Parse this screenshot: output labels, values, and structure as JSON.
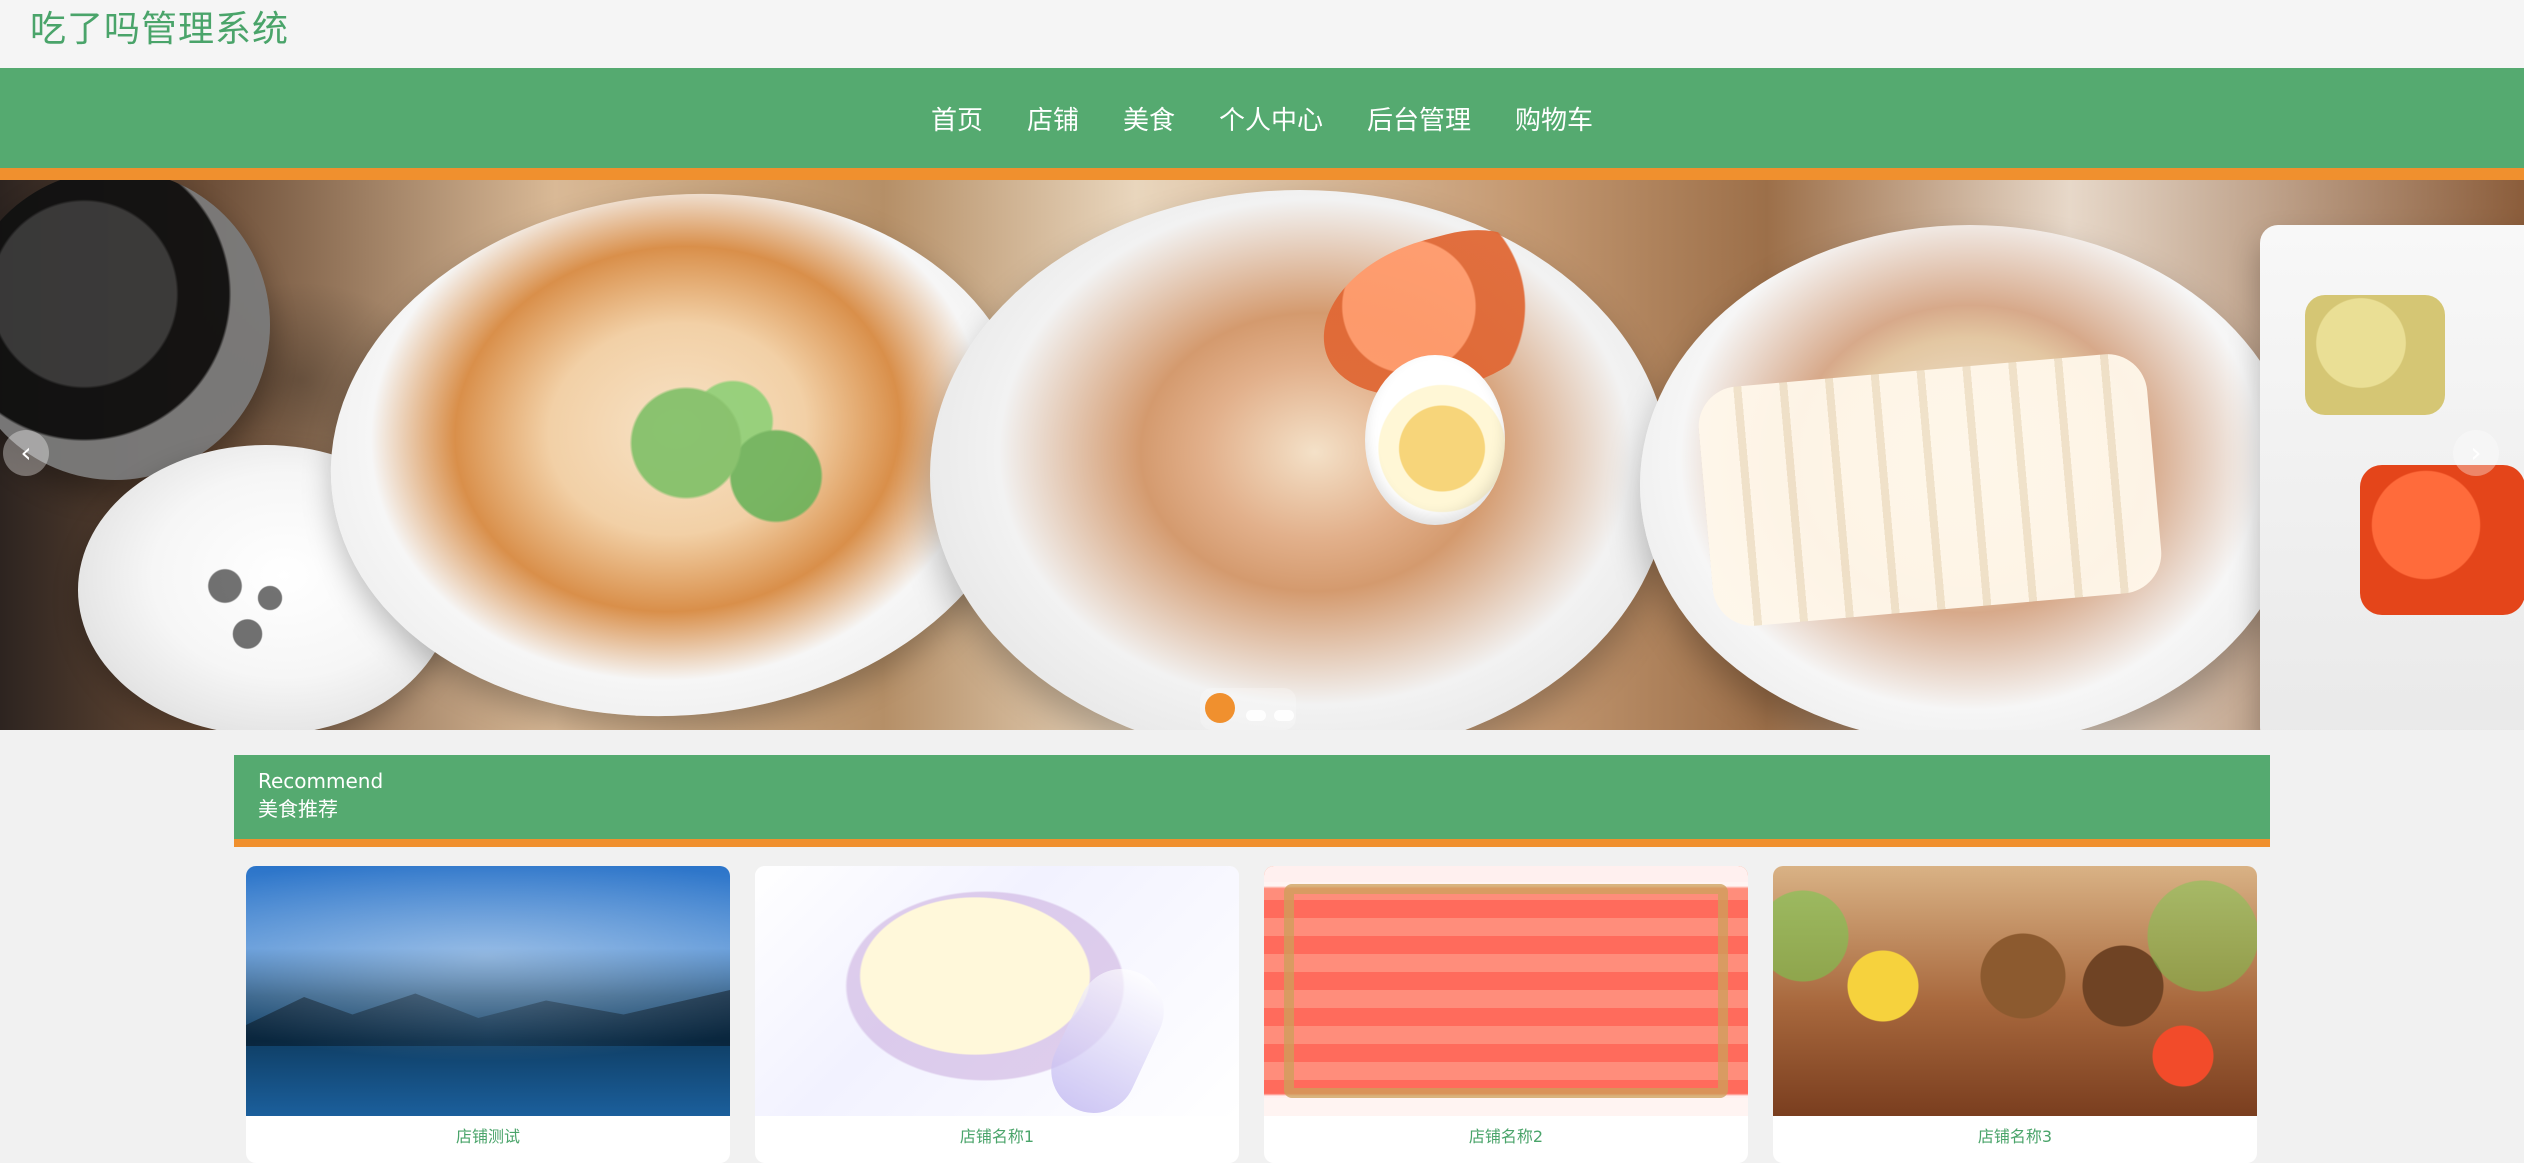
{
  "site": {
    "title": "吃了吗管理系统"
  },
  "nav": {
    "items": [
      {
        "label": "首页"
      },
      {
        "label": "店铺"
      },
      {
        "label": "美食"
      },
      {
        "label": "个人中心"
      },
      {
        "label": "后台管理"
      },
      {
        "label": "购物车"
      }
    ]
  },
  "carousel": {
    "prev_label": "‹",
    "next_label": "›",
    "indicators": {
      "count": 3,
      "active_index": 0
    }
  },
  "recommend": {
    "title_en": "Recommend",
    "title_cn": "美食推荐",
    "cards": [
      {
        "label": "店铺测试"
      },
      {
        "label": "店铺名称1"
      },
      {
        "label": "店铺名称2"
      },
      {
        "label": "店铺名称3"
      }
    ]
  },
  "colors": {
    "brand_green": "#55aa70",
    "accent_orange": "#f0902e",
    "title_green": "#4aa46a",
    "background": "#f1f1f1"
  }
}
